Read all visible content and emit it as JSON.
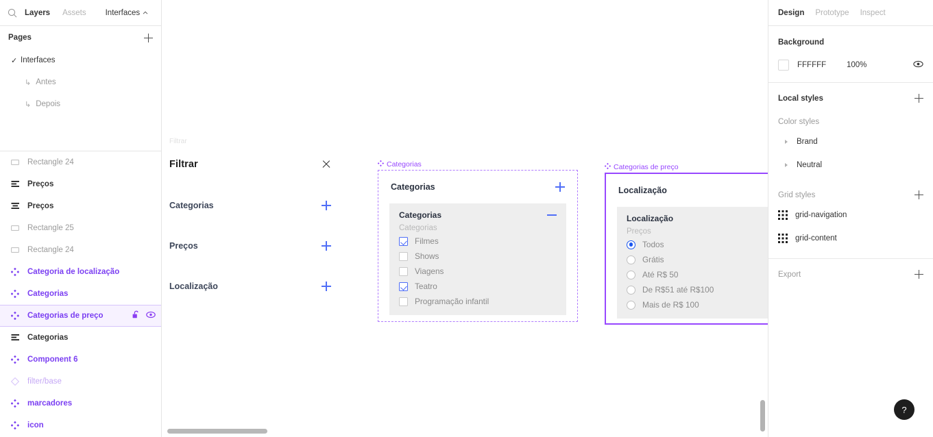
{
  "left_panel": {
    "search_icon": "search-icon",
    "tabs": [
      {
        "label": "Layers",
        "active": true
      },
      {
        "label": "Assets",
        "active": false
      }
    ],
    "interfaces_menu": {
      "label": "Interfaces",
      "caret": "chevron-up-icon"
    },
    "pages": {
      "title": "Pages",
      "add_icon": "plus-icon",
      "items": [
        {
          "label": "Interfaces",
          "checked": true,
          "indent": 0
        },
        {
          "label": "Antes",
          "checked": false,
          "indent": 1
        },
        {
          "label": "Depois",
          "checked": false,
          "indent": 1
        }
      ]
    },
    "layers": [
      {
        "label": "Rectangle 24",
        "icon": "rectangle-icon",
        "style": "grey"
      },
      {
        "label": "Preços",
        "icon": "text-align-icon",
        "style": "black"
      },
      {
        "label": "Preços",
        "icon": "text-align-icon",
        "style": "black"
      },
      {
        "label": "Rectangle 25",
        "icon": "rectangle-icon",
        "style": "grey"
      },
      {
        "label": "Rectangle 24",
        "icon": "rectangle-icon",
        "style": "grey"
      },
      {
        "label": "Categoria de localização",
        "icon": "component-icon",
        "style": "comp"
      },
      {
        "label": "Categorias",
        "icon": "component-icon",
        "style": "comp"
      },
      {
        "label": "Categorias de preço",
        "icon": "component-icon",
        "style": "comp",
        "selected": true,
        "lock_icon": "unlock-icon",
        "visibility_icon": "eye-icon"
      },
      {
        "label": "Categorias",
        "icon": "text-align-icon",
        "style": "black"
      },
      {
        "label": "Component 6",
        "icon": "component-icon",
        "style": "comp"
      },
      {
        "label": "filter/base",
        "icon": "diamond-icon",
        "style": "compfaint"
      },
      {
        "label": "marcadores",
        "icon": "component-icon",
        "style": "comp"
      },
      {
        "label": "icon",
        "icon": "component-icon",
        "style": "comp"
      }
    ]
  },
  "canvas": {
    "frame_label": "Filtrar",
    "filtrar": {
      "title": "Filtrar",
      "close_icon": "close-icon",
      "items": [
        {
          "label": "Categorias",
          "action_icon": "plus-icon"
        },
        {
          "label": "Preços",
          "action_icon": "plus-icon"
        },
        {
          "label": "Localização",
          "action_icon": "plus-icon"
        }
      ]
    },
    "categorias_component": {
      "label": "Categorias",
      "label_icon": "component-icon",
      "header_title": "Categorias",
      "header_icon": "plus-icon",
      "sub_title": "Categorias",
      "sub_icon": "minus-icon",
      "group_label": "Categorias",
      "options": [
        {
          "label": "Filmes",
          "checked": true
        },
        {
          "label": "Shows",
          "checked": false
        },
        {
          "label": "Viagens",
          "checked": false
        },
        {
          "label": "Teatro",
          "checked": true
        },
        {
          "label": "Programação infantil",
          "checked": false
        }
      ]
    },
    "precos_component": {
      "label": "Categorias de preço",
      "label_icon": "component-icon",
      "header_title": "Localização",
      "header_icon": "plus-icon",
      "sub_title": "Localização",
      "sub_icon": "minus-icon",
      "group_label": "Preços",
      "options": [
        {
          "label": "Todos",
          "selected": true
        },
        {
          "label": "Grátis",
          "selected": false
        },
        {
          "label": "Até R$ 50",
          "selected": false
        },
        {
          "label": "De R$51 até R$100",
          "selected": false
        },
        {
          "label": "Mais de R$ 100",
          "selected": false
        }
      ]
    }
  },
  "right_panel": {
    "tabs": [
      {
        "label": "Design",
        "active": true
      },
      {
        "label": "Prototype",
        "active": false
      },
      {
        "label": "Inspect",
        "active": false
      }
    ],
    "background": {
      "title": "Background",
      "hex": "FFFFFF",
      "opacity": "100%",
      "visibility_icon": "eye-icon"
    },
    "local_styles": {
      "title": "Local styles",
      "add_icon": "plus-icon"
    },
    "color_styles": {
      "title": "Color styles",
      "items": [
        {
          "label": "Brand",
          "expand_icon": "triangle-right-icon"
        },
        {
          "label": "Neutral",
          "expand_icon": "triangle-right-icon"
        }
      ]
    },
    "grid_styles": {
      "title": "Grid styles",
      "add_icon": "plus-icon",
      "items": [
        {
          "label": "grid-navigation",
          "icon": "grid-icon"
        },
        {
          "label": "grid-content",
          "icon": "grid-icon"
        }
      ]
    },
    "export": {
      "title": "Export",
      "add_icon": "plus-icon"
    },
    "help_button": {
      "label": "?"
    }
  },
  "colors": {
    "component_purple": "#9747ff",
    "accent_blue": "#4f6ef7",
    "radio_blue": "#1a56f0",
    "selected_row_bg": "#f7f2ff"
  }
}
